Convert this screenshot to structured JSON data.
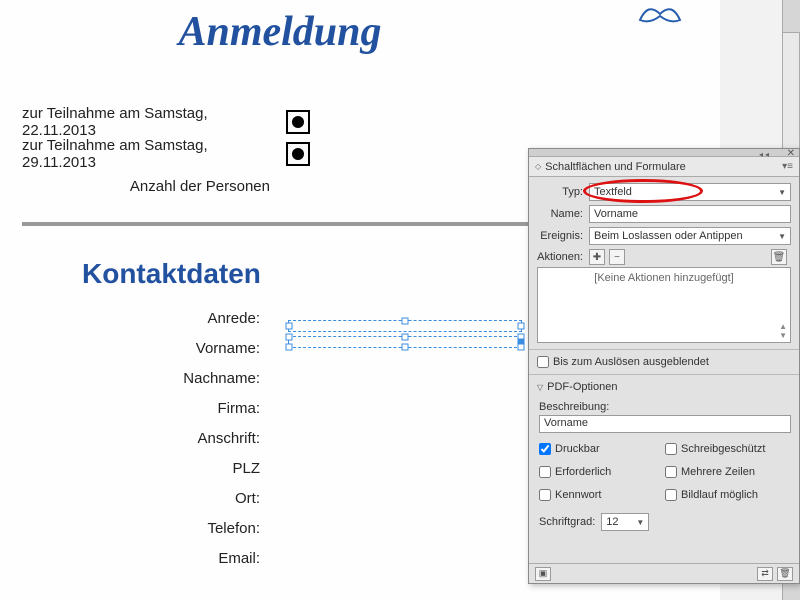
{
  "doc": {
    "title": "Anmeldung",
    "reg_rows": [
      "zur Teilnahme am Samstag, 22.11.2013",
      "zur Teilnahme am Samstag, 29.11.2013",
      "Anzahl der Personen"
    ],
    "section_title": "Kontaktdaten",
    "contact_labels": [
      "Anrede:",
      "Vorname:",
      "Nachname:",
      "Firma:",
      "Anschrift:",
      "PLZ",
      "Ort:",
      "Telefon:",
      "Email:"
    ]
  },
  "panel": {
    "tab_title": "Schaltflächen und Formulare",
    "rows": {
      "typ_label": "Typ:",
      "typ_value": "Textfeld",
      "name_label": "Name:",
      "name_value": "Vorname",
      "ereignis_label": "Ereignis:",
      "ereignis_value": "Beim Loslassen oder Antippen",
      "aktionen_label": "Aktionen:",
      "no_actions": "[Keine Aktionen hinzugefügt]"
    },
    "hide_until_trigger": "Bis zum Auslösen ausgeblendet",
    "pdf": {
      "group": "PDF-Optionen",
      "desc_label": "Beschreibung:",
      "desc_value": "Vorname",
      "druckbar": "Druckbar",
      "schreibgeschuetzt": "Schreibgeschützt",
      "erforderlich": "Erforderlich",
      "mehrere_zeilen": "Mehrere Zeilen",
      "kennwort": "Kennwort",
      "bildlauf": "Bildlauf möglich"
    },
    "font_label": "Schriftgrad:",
    "font_size": "12"
  }
}
